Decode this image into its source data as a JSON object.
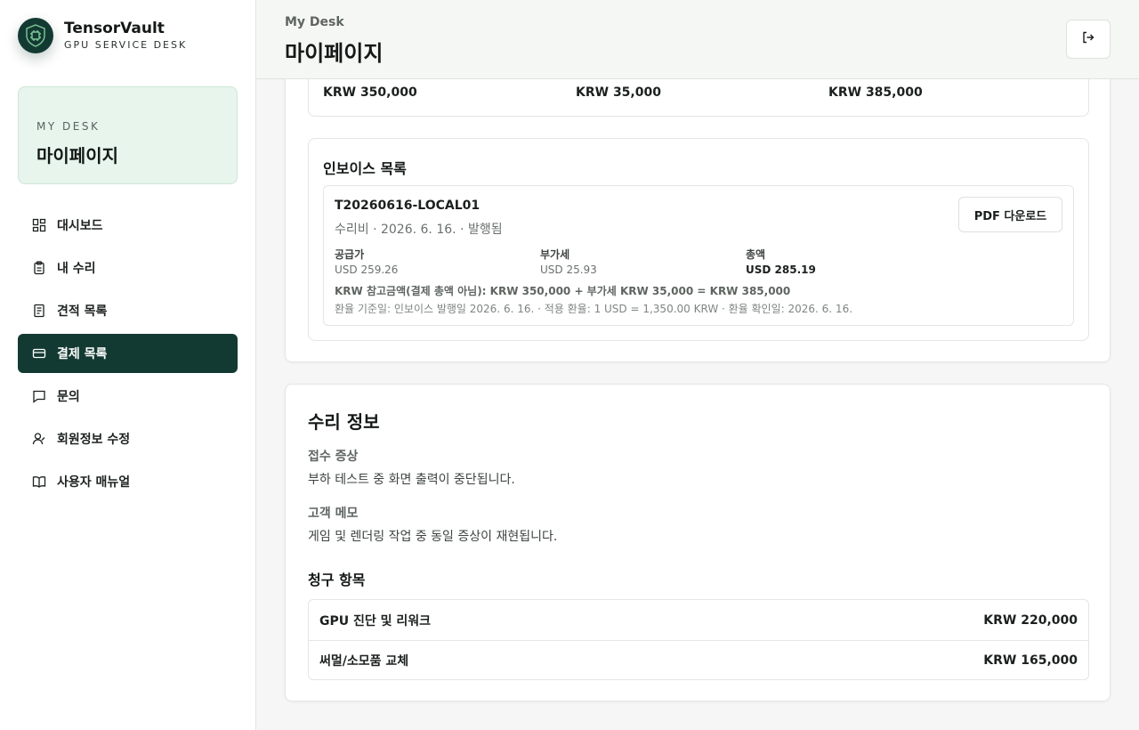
{
  "brand": {
    "name": "TensorVault",
    "subtitle": "GPU SERVICE DESK"
  },
  "sidebar": {
    "desk_eyebrow": "MY DESK",
    "desk_title": "마이페이지",
    "items": [
      {
        "label": "대시보드",
        "icon": "dashboard-icon",
        "active": false
      },
      {
        "label": "내 수리",
        "icon": "clipboard-icon",
        "active": false
      },
      {
        "label": "견적 목록",
        "icon": "document-icon",
        "active": false
      },
      {
        "label": "결제 목록",
        "icon": "credit-card-icon",
        "active": true
      },
      {
        "label": "문의",
        "icon": "chat-icon",
        "active": false
      },
      {
        "label": "회원정보 수정",
        "icon": "user-edit-icon",
        "active": false
      },
      {
        "label": "사용자 매뉴얼",
        "icon": "book-icon",
        "active": false
      }
    ]
  },
  "header": {
    "eyebrow": "My Desk",
    "title": "마이페이지",
    "logout_icon": "logout-icon"
  },
  "summary": {
    "supply": "KRW 350,000",
    "vat": "KRW 35,000",
    "total": "KRW 385,000"
  },
  "invoices": {
    "heading": "인보이스 목록",
    "item": {
      "id": "T20260616-LOCAL01",
      "meta": "수리비 · 2026. 6. 16. · 발행됨",
      "pdf_button": "PDF 다운로드",
      "supply_label": "공급가",
      "supply_value": "USD 259.26",
      "vat_label": "부가세",
      "vat_value": "USD 25.93",
      "total_label": "총액",
      "total_value": "USD 285.19",
      "krw_reference": "KRW 참고금액(결제 총액 아님): KRW 350,000 + 부가세 KRW 35,000 = KRW 385,000",
      "rate_note": "환율 기준일: 인보이스 발행일 2026. 6. 16. · 적용 환율: 1 USD = 1,350.00 KRW · 환율 확인일: 2026. 6. 16."
    }
  },
  "repair": {
    "title": "수리 정보",
    "symptom_label": "접수 증상",
    "symptom_value": "부하 테스트 중 화면 출력이 중단됩니다.",
    "memo_label": "고객 메모",
    "memo_value": "게임 및 렌더링 작업 중 동일 증상이 재현됩니다.",
    "billing_heading": "청구 항목",
    "billing_items": [
      {
        "name": "GPU 진단 및 리워크",
        "amount": "KRW 220,000"
      },
      {
        "name": "써멀/소모품 교체",
        "amount": "KRW 165,000"
      }
    ]
  },
  "colors": {
    "accent": "#133a32",
    "desk_card": "#e7f5ec"
  }
}
